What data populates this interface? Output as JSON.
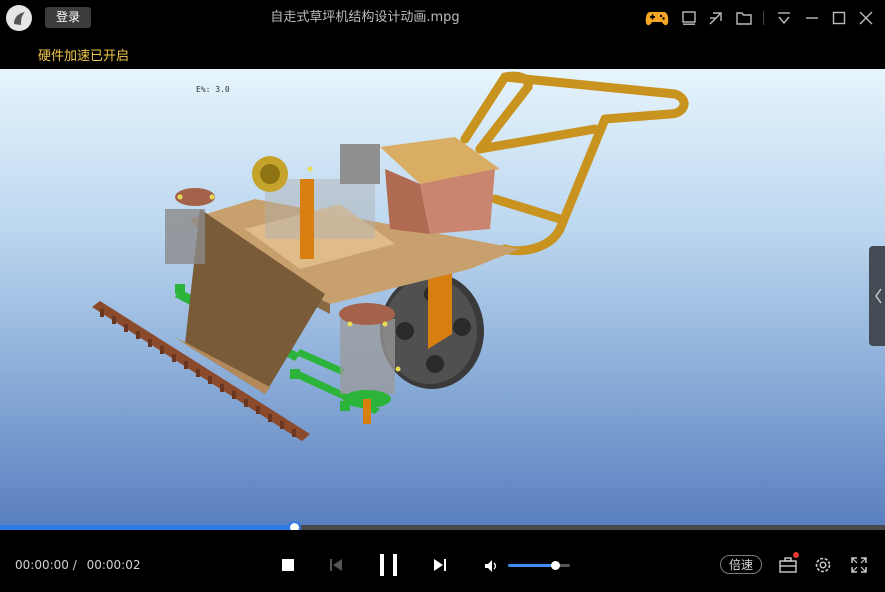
{
  "titlebar": {
    "login_label": "登录",
    "title": "自走式草坪机结构设计动画.mpg",
    "icons": [
      "game-icon",
      "mini-mode-icon",
      "screencast-icon",
      "folder-icon",
      "menu-icon",
      "minimize-icon",
      "maximize-icon",
      "close-icon"
    ]
  },
  "banner": {
    "hw_accel": "硬件加速已开启"
  },
  "viewport": {
    "overlay_text": "E%: 3.0"
  },
  "playback": {
    "current_time": "00:00:00 /",
    "total_time": "00:00:02",
    "progress": 0.332,
    "volume": 0.76,
    "speed_label": "倍速"
  },
  "colors": {
    "accent": "#2d7be5",
    "banner_text": "#f2c94c",
    "game_icon": "#f5a623"
  }
}
